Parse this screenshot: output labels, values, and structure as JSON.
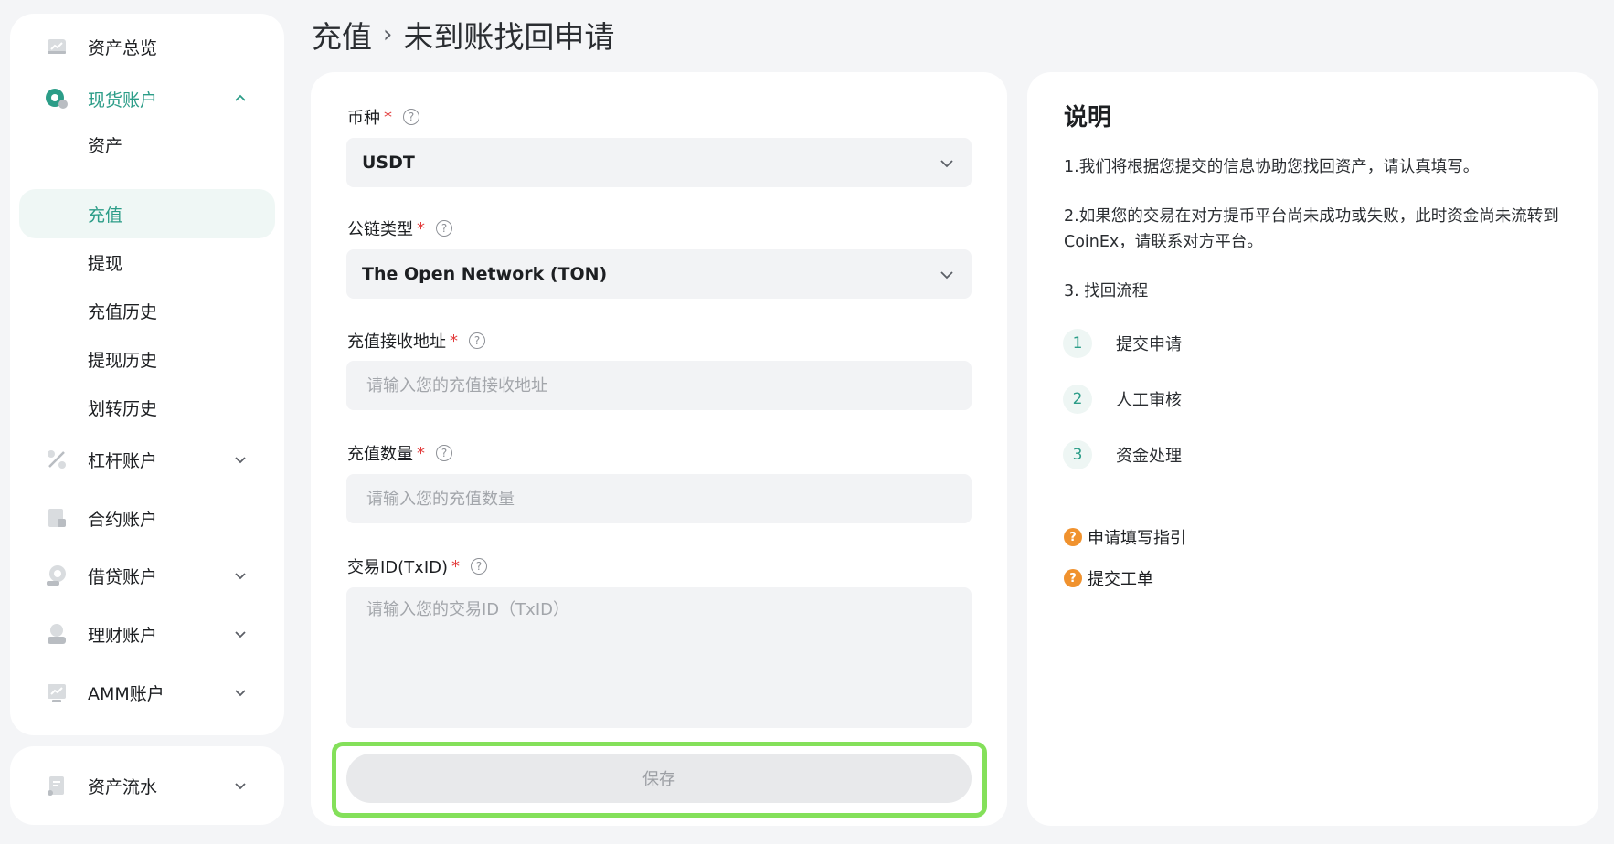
{
  "sidebar": {
    "overview_label": "资产总览",
    "spot": {
      "label": "现货账户",
      "children": [
        "资产",
        "充值",
        "提现",
        "充值历史",
        "提现历史",
        "划转历史"
      ]
    },
    "margin_label": "杠杆账户",
    "futures_label": "合约账户",
    "loan_label": "借贷账户",
    "finance_label": "理财账户",
    "amm_label": "AMM账户",
    "flow_label": "资产流水"
  },
  "breadcrumb": {
    "parent": "充值",
    "separator": "›",
    "current": "未到账找回申请"
  },
  "form": {
    "coin": {
      "label": "币种",
      "value": "USDT"
    },
    "chain": {
      "label": "公链类型",
      "value": "The Open Network (TON)"
    },
    "address": {
      "label": "充值接收地址",
      "placeholder": "请输入您的充值接收地址"
    },
    "amount": {
      "label": "充值数量",
      "placeholder": "请输入您的充值数量"
    },
    "txid": {
      "label": "交易ID(TxID)",
      "placeholder": "请输入您的交易ID（TxID）"
    },
    "required_mark": "*",
    "help_mark": "?",
    "save_label": "保存"
  },
  "info": {
    "title": "说明",
    "p1": "1.我们将根据您提交的信息协助您找回资产，请认真填写。",
    "p2": "2.如果您的交易在对方提币平台尚未成功或失败，此时资金尚未流转到CoinEx，请联系对方平台。",
    "p3": "3. 找回流程",
    "steps": [
      {
        "num": "1",
        "label": "提交申请"
      },
      {
        "num": "2",
        "label": "人工审核"
      },
      {
        "num": "3",
        "label": "资金处理"
      }
    ],
    "link1": "申请填写指引",
    "link2": "提交工单",
    "link_icon": "?"
  },
  "colors": {
    "accent": "#2c9d88",
    "required": "#e23b3b",
    "highlight": "#84e05a",
    "link_icon": "#f0922e"
  }
}
